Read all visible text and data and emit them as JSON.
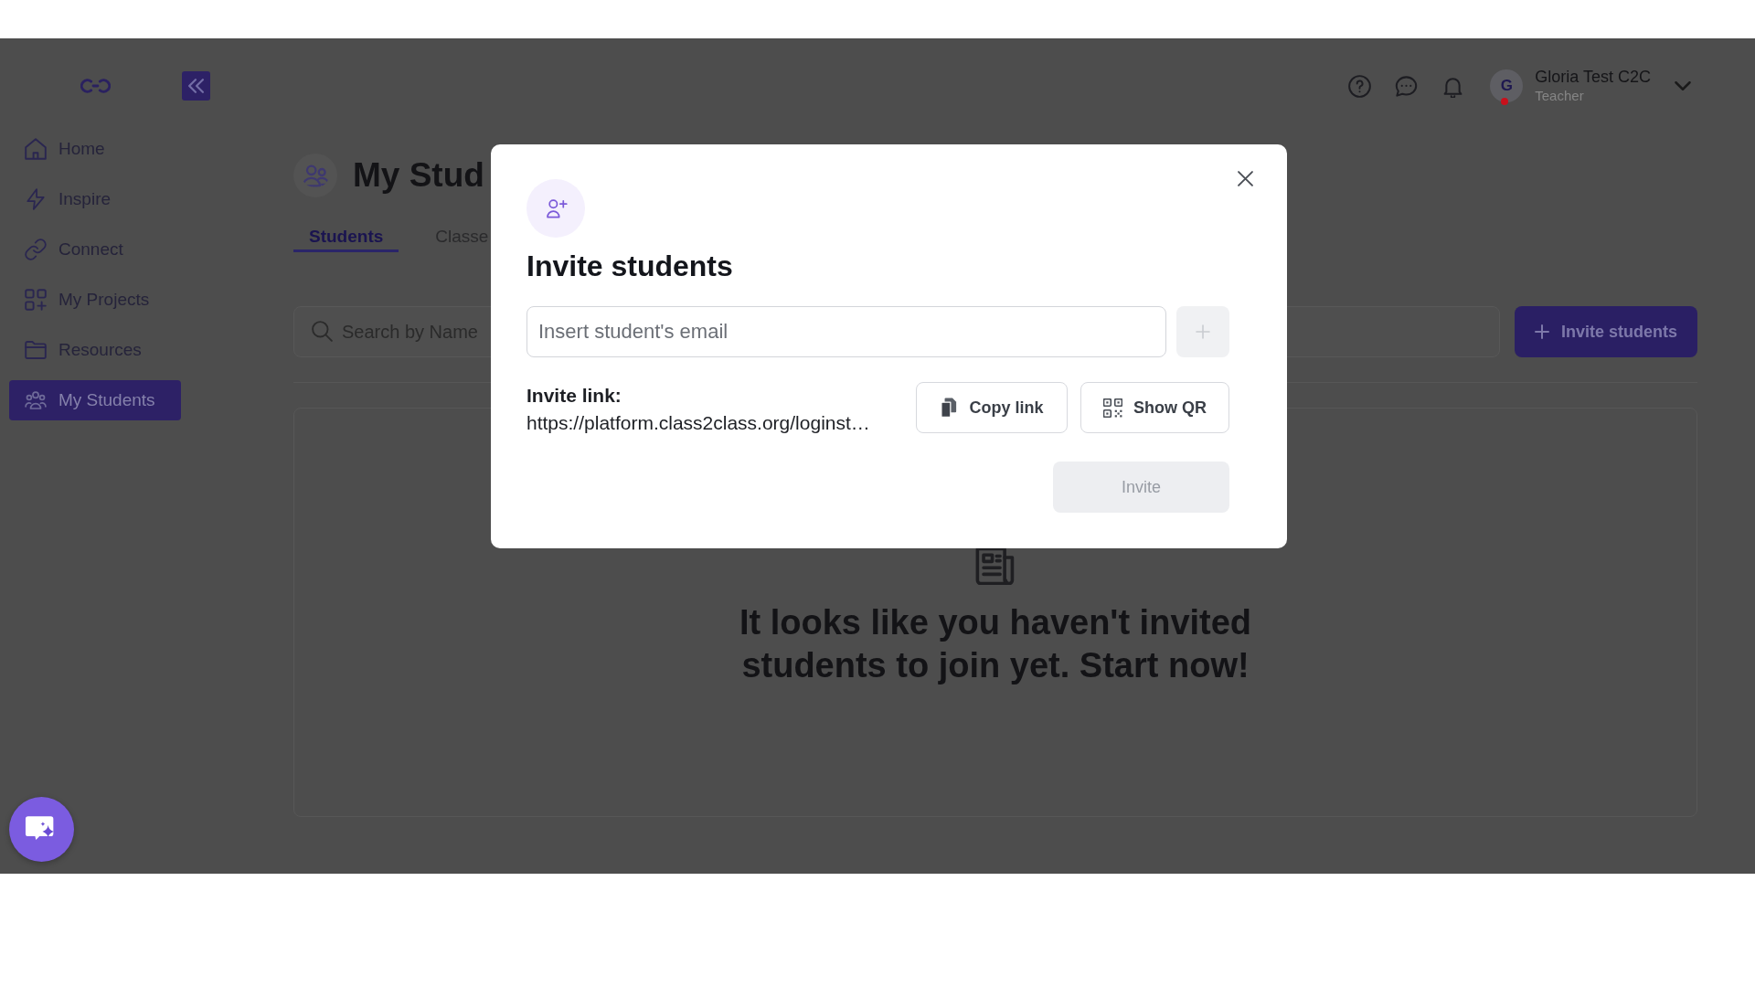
{
  "sidebar": {
    "items": [
      {
        "label": "Home",
        "selected": false
      },
      {
        "label": "Inspire",
        "selected": false
      },
      {
        "label": "Connect",
        "selected": false
      },
      {
        "label": "My Projects",
        "selected": false
      },
      {
        "label": "Resources",
        "selected": false
      },
      {
        "label": "My Students",
        "selected": true
      }
    ]
  },
  "header": {
    "user": {
      "initial": "G",
      "name": "Gloria Test C2C",
      "role": "Teacher",
      "status_dot": true
    }
  },
  "page": {
    "title": "My Stud",
    "tabs": [
      {
        "label": "Students",
        "selected": true
      },
      {
        "label": "Classe",
        "selected": false
      }
    ],
    "search": {
      "placeholder": "Search by Name"
    },
    "invite_button": "Invite students",
    "empty_state": {
      "message": "It looks like you haven't invited students to join yet. Start now!"
    }
  },
  "modal": {
    "title": "Invite students",
    "email_field": {
      "placeholder": "Insert student's email"
    },
    "add_button": {
      "disabled": true
    },
    "invite_link": {
      "label": "Invite link:",
      "url": "https://platform.class2class.org/loginst…"
    },
    "copy_button": "Copy link",
    "qr_button": "Show QR",
    "invite_button": {
      "label": "Invite",
      "disabled": true
    }
  }
}
